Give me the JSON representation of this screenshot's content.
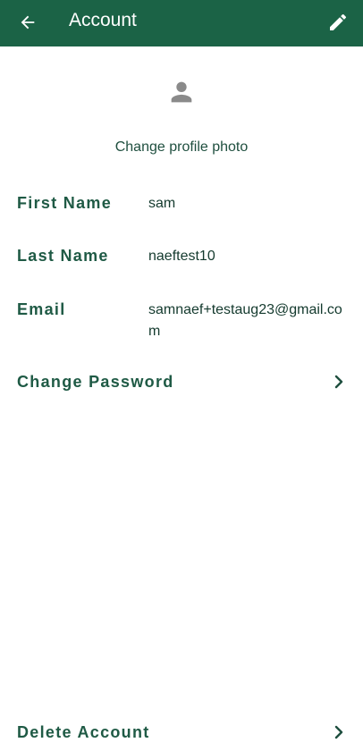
{
  "header": {
    "title": "Account",
    "back_icon": "arrow-left-icon",
    "edit_icon": "pencil-icon",
    "background_color": "#1b6346"
  },
  "profile": {
    "avatar_icon": "person-icon",
    "change_photo_label": "Change profile photo"
  },
  "fields": {
    "first_name_label": "First Name",
    "first_name_value": "sam",
    "last_name_label": "Last Name",
    "last_name_value": "naeftest10",
    "email_label": "Email",
    "email_value": "samnaef+testaug23@gmail.com"
  },
  "actions": {
    "change_password_label": "Change Password",
    "delete_account_label": "Delete Account",
    "chevron_icon": "chevron-right-icon"
  }
}
